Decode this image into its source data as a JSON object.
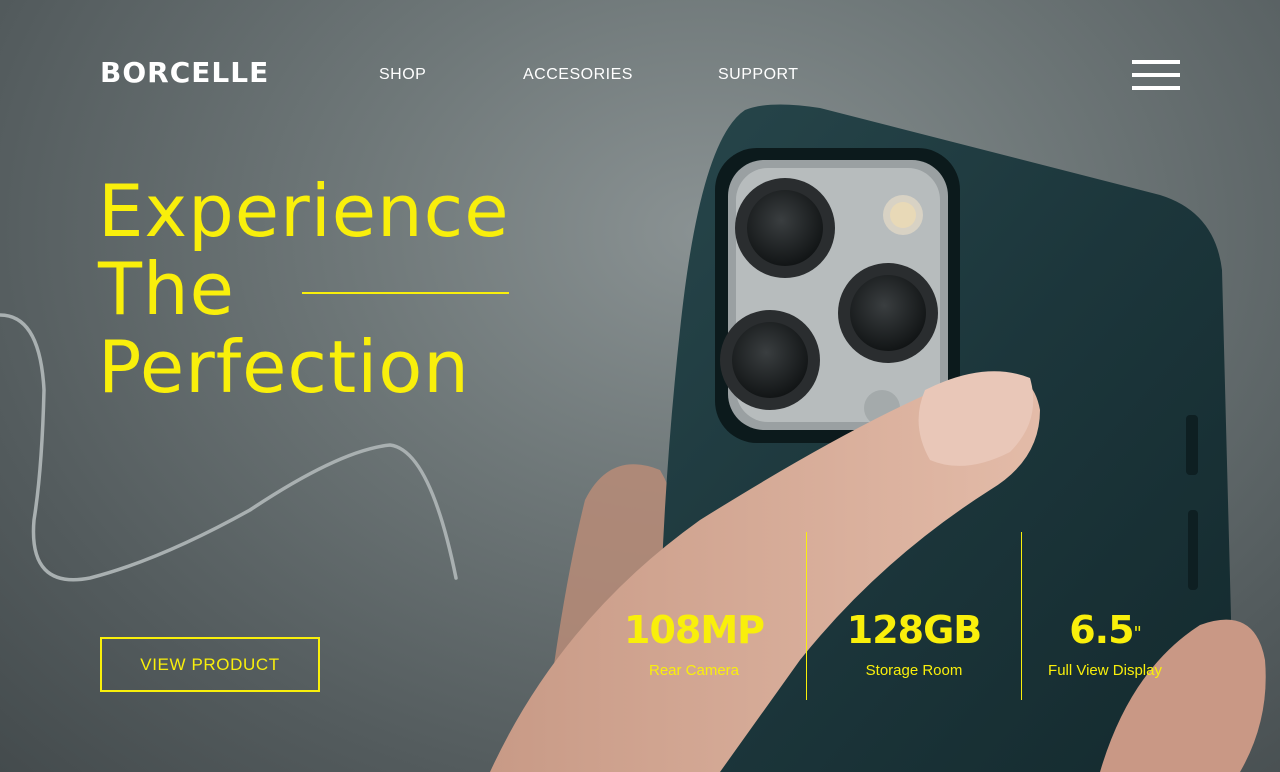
{
  "brand": {
    "logo": "BORCELLE"
  },
  "nav": {
    "items": [
      {
        "label": "SHOP"
      },
      {
        "label": "ACCESORIES"
      },
      {
        "label": "SUPPORT"
      }
    ]
  },
  "hero": {
    "title_lines": [
      "Experience",
      "The",
      "Perfection"
    ],
    "cta_label": "VIEW PRODUCT"
  },
  "stats": [
    {
      "value": "108MP",
      "label": "Rear Camera"
    },
    {
      "value": "128GB",
      "label": "Storage Room"
    },
    {
      "value": "6.5",
      "unit": "\"",
      "label": "Full View Display"
    }
  ],
  "colors": {
    "accent": "#f9ef0b",
    "text": "#ffffff",
    "background": "#6f7879",
    "phone_case": "#1f3a3f"
  },
  "icons": {
    "menu": "hamburger-menu-icon"
  }
}
